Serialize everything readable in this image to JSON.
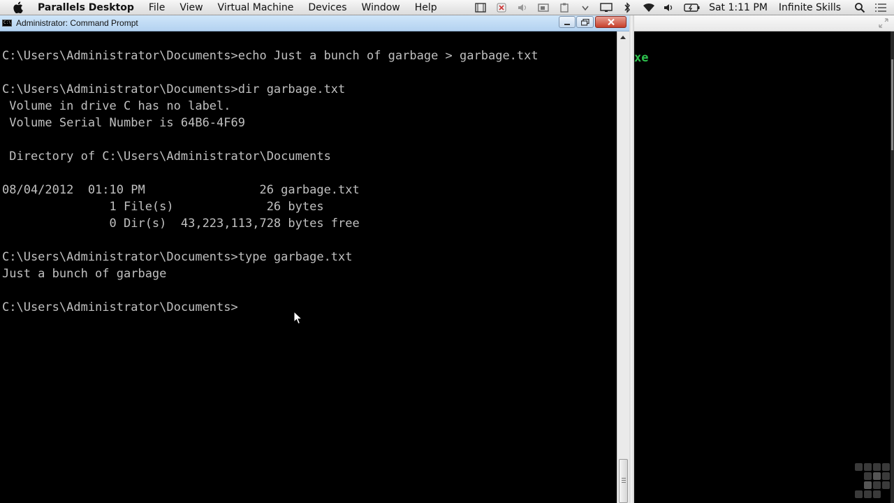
{
  "menubar": {
    "apple_icon": "apple-logo-icon",
    "app_name": "Parallels Desktop",
    "items": [
      "File",
      "View",
      "Virtual Machine",
      "Devices",
      "Window",
      "Help"
    ],
    "clock": "Sat 1:11 PM",
    "user": "Infinite Skills",
    "status_icons": [
      "screen-capture-icon",
      "parallels-icon",
      "volume-muted-icon",
      "window-icon",
      "clipboard-icon",
      "chevron-icon",
      "display-icon",
      "bluetooth-icon",
      "wifi-icon",
      "volume-icon",
      "battery-icon",
      "spotlight-search-icon",
      "menu-list-icon"
    ]
  },
  "window": {
    "title": "Administrator: Command Prompt",
    "icon": "cmd-icon",
    "controls": [
      "minimize-icon",
      "restore-icon",
      "close-icon"
    ]
  },
  "console": {
    "lines": [
      "",
      "C:\\Users\\Administrator\\Documents>echo Just a bunch of garbage > garbage.txt",
      "",
      "C:\\Users\\Administrator\\Documents>dir garbage.txt",
      " Volume in drive C has no label.",
      " Volume Serial Number is 64B6-4F69",
      "",
      " Directory of C:\\Users\\Administrator\\Documents",
      "",
      "08/04/2012  01:10 PM                26 garbage.txt",
      "               1 File(s)             26 bytes",
      "               0 Dir(s)  43,223,113,728 bytes free",
      "",
      "C:\\Users\\Administrator\\Documents>type garbage.txt",
      "Just a bunch of garbage",
      "",
      "C:\\Users\\Administrator\\Documents>"
    ]
  },
  "right_panel": {
    "fragment": "xe"
  },
  "colors": {
    "console_bg": "#000000",
    "console_text": "#c0c0c0",
    "titlebar": "#bfdaf3",
    "right_text": "#2ec44f"
  }
}
